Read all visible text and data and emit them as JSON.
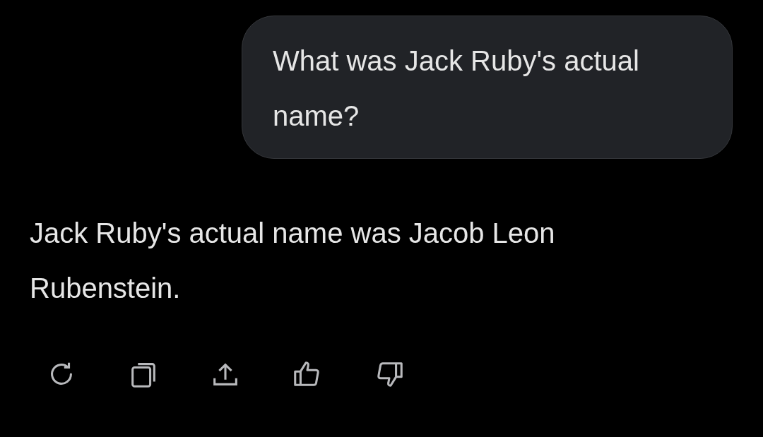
{
  "user_message": {
    "text": "What was Jack Ruby's actual name?"
  },
  "assistant_message": {
    "text": "Jack Ruby's actual name was Jacob Leon Rubenstein."
  }
}
